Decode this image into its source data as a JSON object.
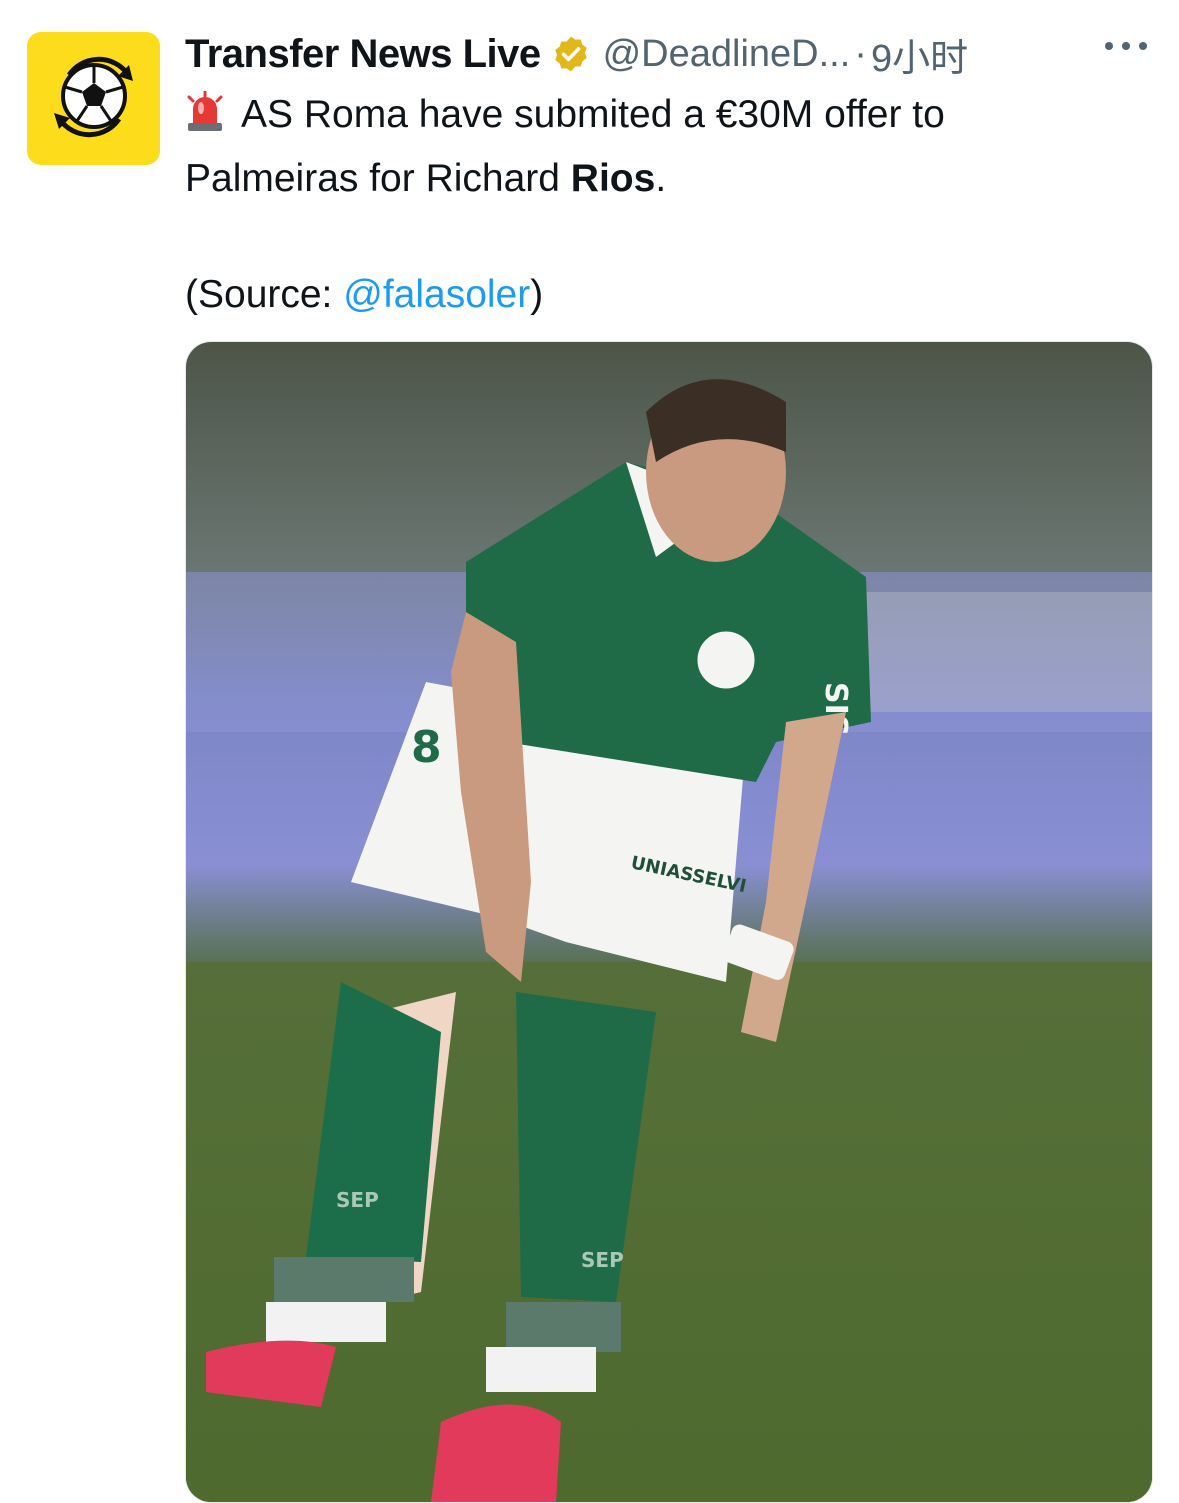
{
  "tweet": {
    "author_name": "Transfer News Live",
    "handle": "@DeadlineD...",
    "separator": "·",
    "time": "9小时",
    "body_line1": "AS Roma have submited a €30M offer to",
    "body_line2_prefix": "Palmeiras for Richard ",
    "body_line2_bold": "Rios",
    "body_line2_suffix": ".",
    "source_prefix": "(Source: ",
    "source_link": "@falasoler",
    "source_suffix": ")"
  },
  "icons": {
    "avatar": "soccer-ball-transfer-logo",
    "verified": "gold-verified-badge",
    "more": "more-dots-icon",
    "siren": "rotating-light-emoji"
  },
  "photo": {
    "shirt_number": "8",
    "shorts_sponsor": "UNIASSELVI",
    "sleeve_sponsor": "SIS",
    "sock_mark": "SEP"
  },
  "colors": {
    "avatar_bg": "#fddc1c",
    "link": "#1d9bf0",
    "meta_gray": "#536471",
    "verified_gold": "#e2b719",
    "kit_green": "#1f6b48"
  }
}
